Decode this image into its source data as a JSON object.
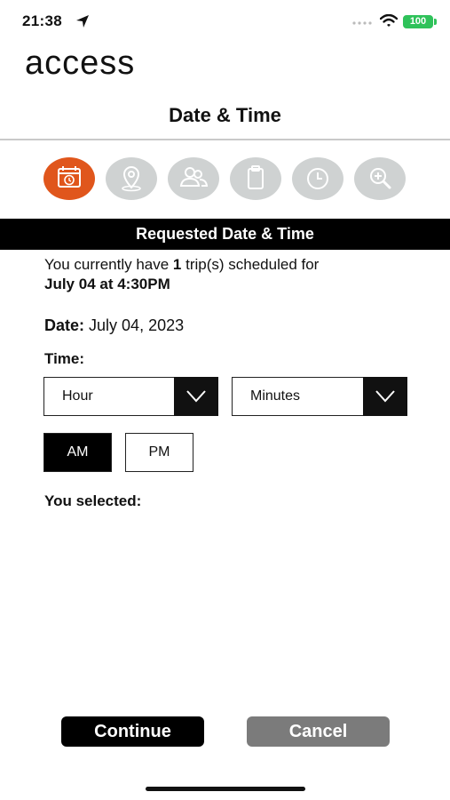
{
  "status_bar": {
    "time": "21:38",
    "battery": "100"
  },
  "app": {
    "logo": "access"
  },
  "header": {
    "title": "Date & Time"
  },
  "steps": [
    {
      "icon": "calendar-icon",
      "active": true
    },
    {
      "icon": "location-pin-icon",
      "active": false
    },
    {
      "icon": "passengers-icon",
      "active": false
    },
    {
      "icon": "clipboard-icon",
      "active": false
    },
    {
      "icon": "clock-icon",
      "active": false
    },
    {
      "icon": "review-search-icon",
      "active": false
    }
  ],
  "section": {
    "title": "Requested Date & Time"
  },
  "trip_info": {
    "prefix": "You currently have ",
    "count": "1",
    "suffix": " trip(s) scheduled for",
    "datetime": "July 04 at 4:30PM"
  },
  "date": {
    "label": "Date:",
    "value": "July 04, 2023"
  },
  "time": {
    "label": "Time:",
    "hour_placeholder": "Hour",
    "minutes_placeholder": "Minutes",
    "am_label": "AM",
    "pm_label": "PM",
    "selected_meridiem": "AM"
  },
  "selection": {
    "label": "You selected:"
  },
  "actions": {
    "continue_label": "Continue",
    "cancel_label": "Cancel"
  },
  "colors": {
    "accent": "#e0561c",
    "inactive_step": "#cfd2d2",
    "battery": "#2fc25a",
    "cancel": "#7b7b7b"
  }
}
